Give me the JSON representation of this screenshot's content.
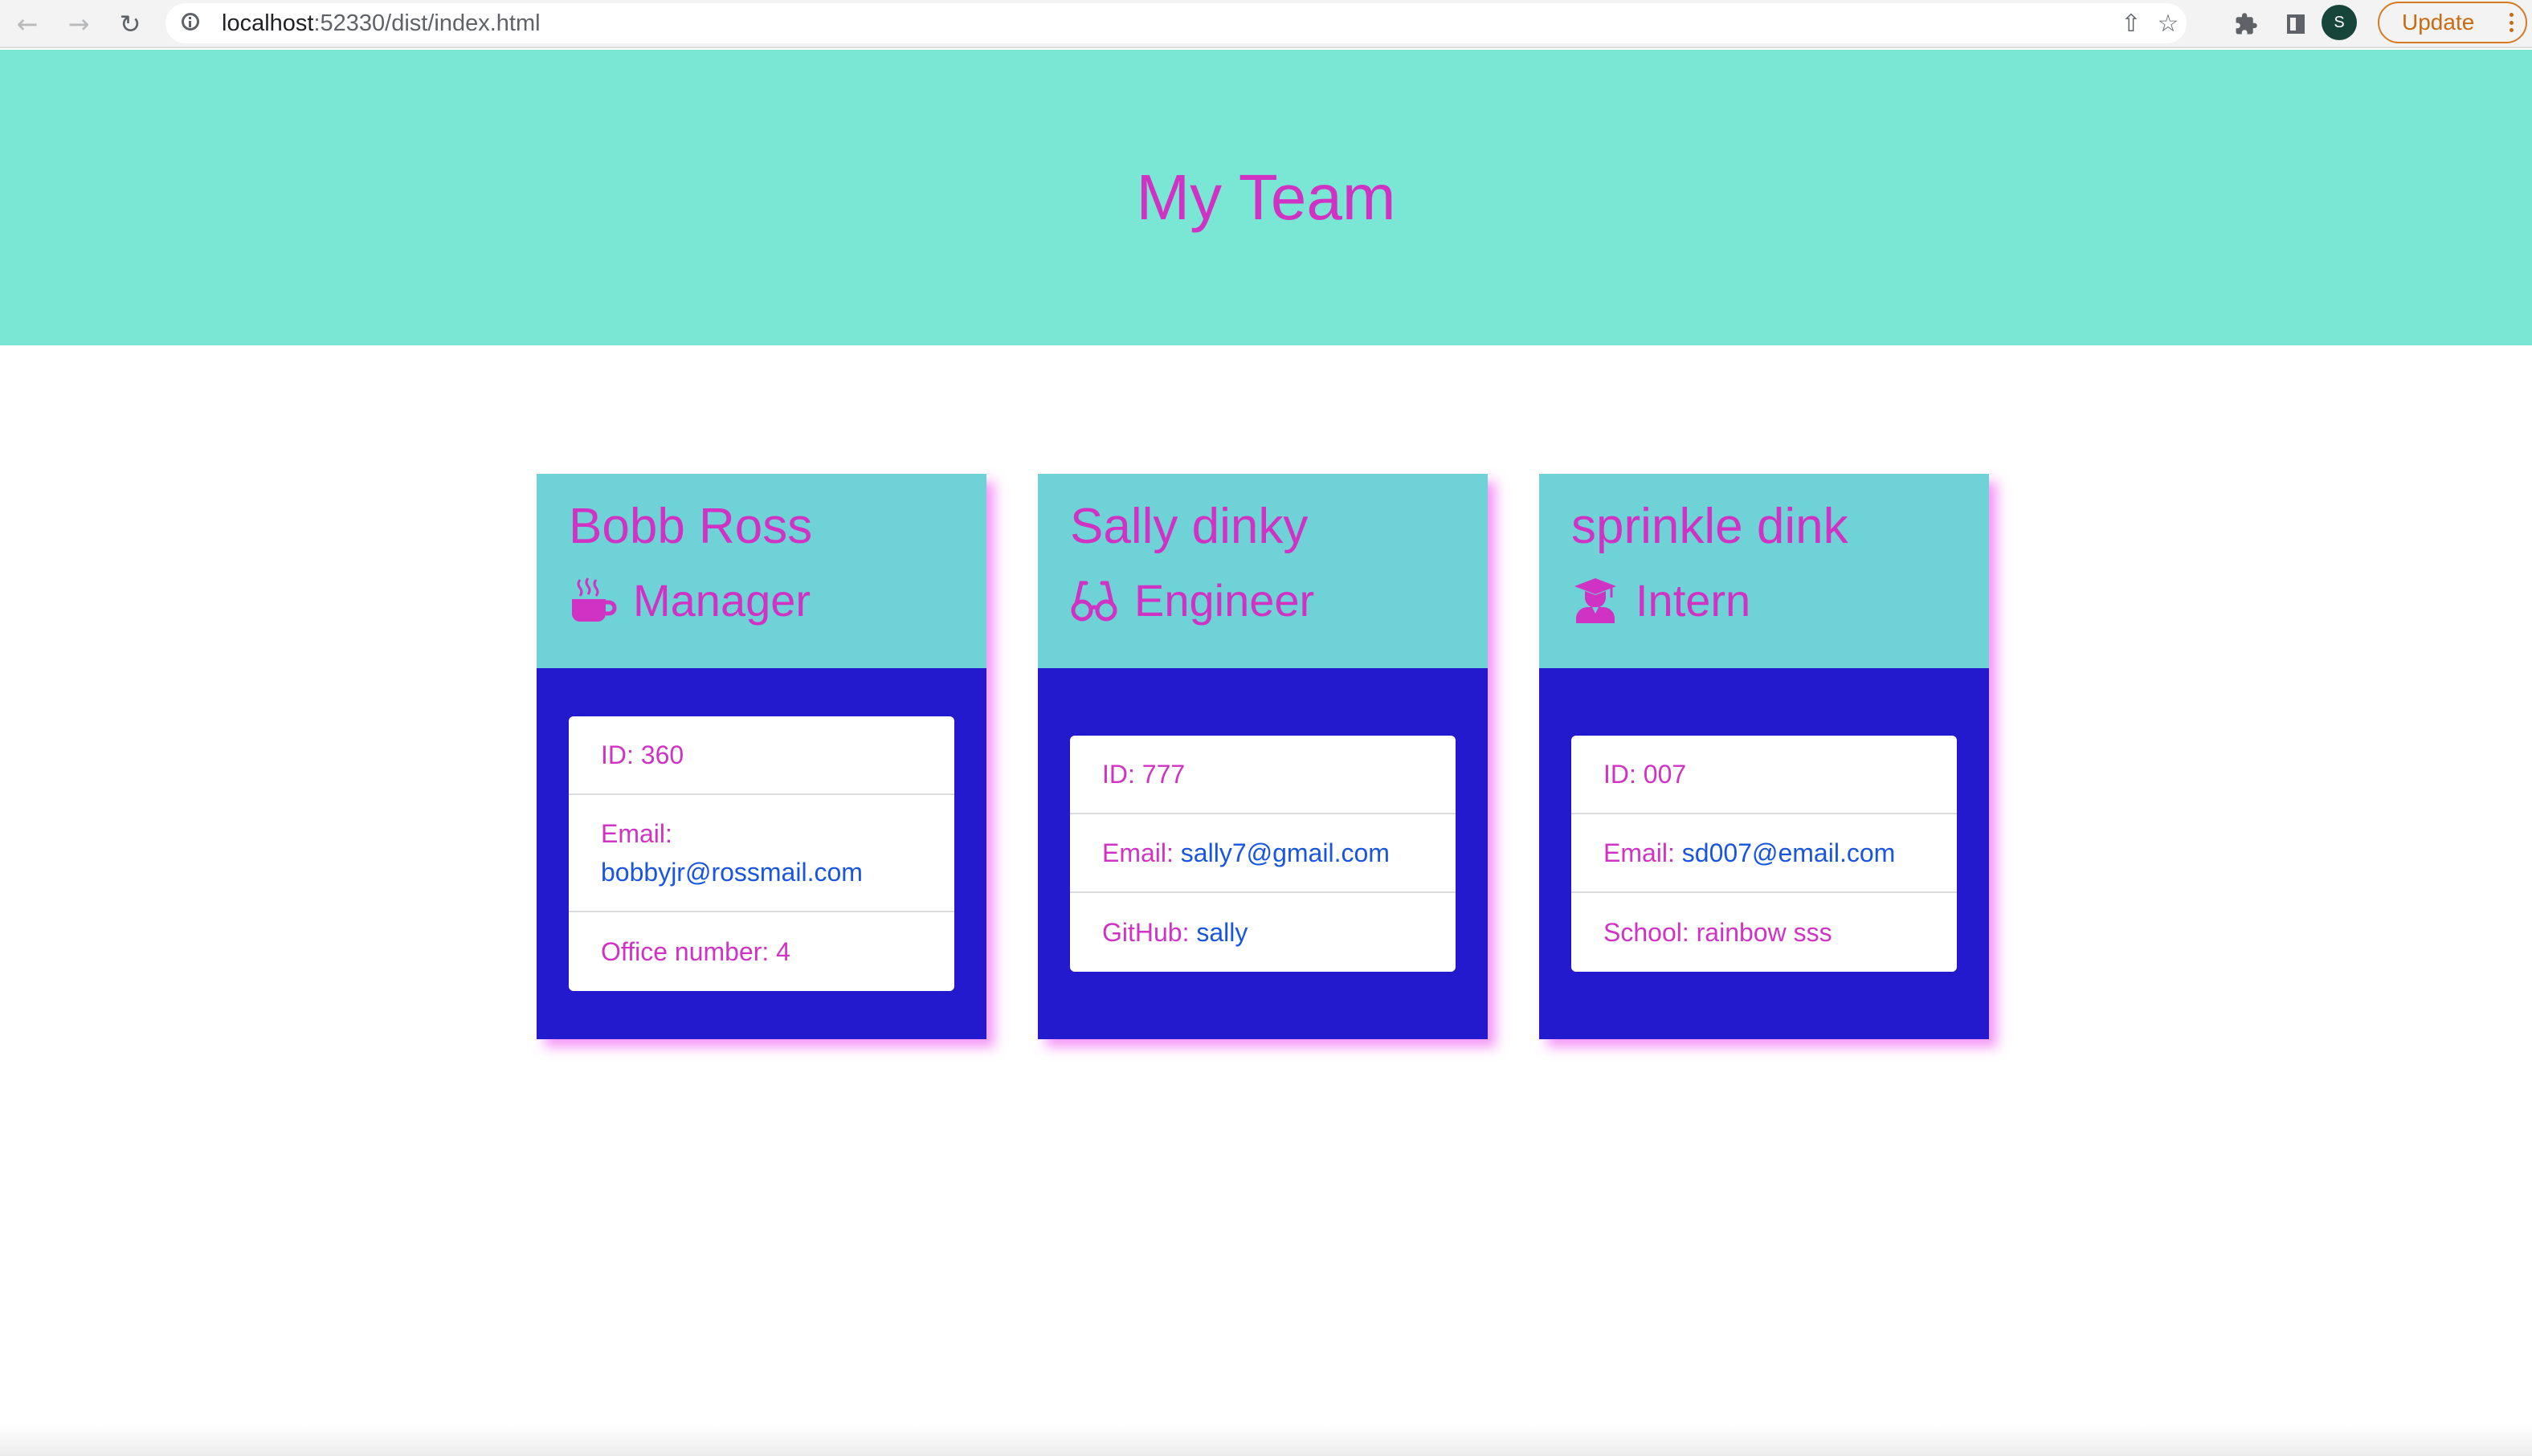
{
  "browser": {
    "url_host": "localhost",
    "url_path": ":52330/dist/index.html",
    "update_label": "Update",
    "profile_initial": "S",
    "icons": [
      "back-icon",
      "forward-icon",
      "reload-icon",
      "info-icon",
      "share-icon",
      "star-icon",
      "extensions-icon",
      "side-panel-icon",
      "menu-icon"
    ]
  },
  "page": {
    "title": "My Team",
    "colors": {
      "header_bg": "#7ae6d4",
      "accent_text": "#d033c4",
      "card_header_bg": "#6fd2d6",
      "card_body_bg": "#221acc",
      "link": "#1a55e0",
      "shadow": "#f276f3"
    }
  },
  "team": [
    {
      "name": "Bobb Ross",
      "role": "Manager",
      "role_icon": "mug-icon",
      "id_label": "ID: 360",
      "email_label": "Email:",
      "email": "bobbyjr@rossmail.com",
      "extra_label": "Office number: 4",
      "extra_value": ""
    },
    {
      "name": "Sally dinky",
      "role": "Engineer",
      "role_icon": "glasses-icon",
      "id_label": "ID: 777",
      "email_label": "Email:",
      "email": "sally7@gmail.com",
      "extra_label": "GitHub:",
      "extra_value": "sally"
    },
    {
      "name": "sprinkle dink",
      "role": "Intern",
      "role_icon": "graduate-icon",
      "id_label": "ID: 007",
      "email_label": "Email:",
      "email": "sd007@email.com",
      "extra_label": "School: rainbow sss",
      "extra_value": ""
    }
  ]
}
